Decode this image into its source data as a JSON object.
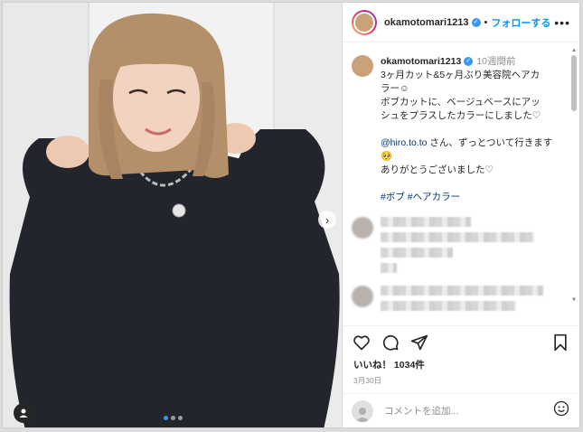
{
  "post": {
    "username": "okamotomari1213",
    "follow_label": "フォローする",
    "more_label": "•••"
  },
  "caption": {
    "username": "okamotomari1213",
    "time": "10週間前",
    "line1": "3ヶ月カット&5ヶ月ぶり美容院ヘアカ",
    "line2": "ラー☺︎",
    "line3": "ボブカットに、ベージュベースにアッ",
    "line4": "シュをプラスしたカラーにしました♡",
    "mention": "@hiro.to.to",
    "line5": " さん、ずっとついて行きます",
    "line5_emoji": "🥺",
    "line6": "ありがとうございました♡",
    "tags": [
      "#ボブ",
      "#ヘアカラー"
    ]
  },
  "likes": {
    "prefix": "いいね！",
    "count": "1034件"
  },
  "date": "3月30日",
  "comment_input": {
    "placeholder": "コメントを追加..."
  },
  "carousel": {
    "slide_count": 3,
    "active_index": 0
  },
  "colors": {
    "follow_blue": "#0095f6",
    "verified_blue": "#3897f0",
    "link_color": "#00376b",
    "sweater": "#22252b",
    "hair": "#b38f6a"
  },
  "icons": [
    "heart-icon",
    "comment-icon",
    "share-icon",
    "bookmark-icon",
    "emoji-icon",
    "chevron-right-icon",
    "user-tag-icon",
    "verified-icon"
  ]
}
